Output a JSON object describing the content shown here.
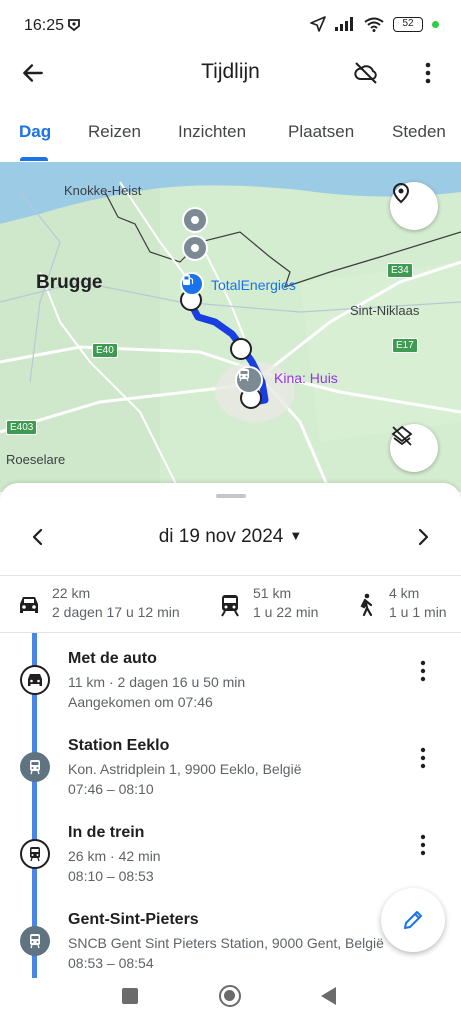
{
  "status_bar": {
    "time": "16:25",
    "battery": "52"
  },
  "app_bar": {
    "title": "Tijdlijn"
  },
  "tabs": [
    {
      "label": "Dag",
      "active": true
    },
    {
      "label": "Reizen",
      "active": false
    },
    {
      "label": "Inzichten",
      "active": false
    },
    {
      "label": "Plaatsen",
      "active": false
    },
    {
      "label": "Steden",
      "active": false
    }
  ],
  "map": {
    "cities": [
      "Knokke-Heist",
      "Brugge",
      "Sint-Niklaas",
      "Roeselare"
    ],
    "roads": [
      "E34",
      "E40",
      "E17",
      "E403"
    ],
    "pois": [
      {
        "label": "TotalEnergies",
        "color": "#1a73e8"
      },
      {
        "label": "Kina: Huis",
        "color": "#9334e6"
      }
    ]
  },
  "date_nav": {
    "date": "di 19 nov 2024"
  },
  "summary": [
    {
      "icon": "car-icon",
      "distance": "22 km",
      "duration": "2 dagen 17 u 12 min"
    },
    {
      "icon": "train-icon",
      "distance": "51 km",
      "duration": "1 u 22 min"
    },
    {
      "icon": "walk-icon",
      "distance": "4 km",
      "duration": "1 u 1 min"
    }
  ],
  "timeline": [
    {
      "type": "activity",
      "icon": "car-icon",
      "title": "Met de auto",
      "subtitle": "11 km · 2 dagen 16 u 50 min",
      "time": "Aangekomen om 07:46"
    },
    {
      "type": "place",
      "icon": "train-station-icon",
      "title": "Station Eeklo",
      "subtitle": "Kon. Astridplein 1, 9900 Eeklo, België",
      "time": "07:46 – 08:10"
    },
    {
      "type": "activity",
      "icon": "train-icon",
      "title": "In de trein",
      "subtitle": "26 km · 42 min",
      "time": "08:10 – 08:53"
    },
    {
      "type": "place",
      "icon": "train-station-icon",
      "title": "Gent-Sint-Pieters",
      "subtitle": "SNCB Gent Sint Pieters Station, 9000 Gent, België",
      "time": "08:53 – 08:54"
    }
  ],
  "colors": {
    "accent": "#1a73e8",
    "timeline": "#4a86e8",
    "route": "#1a3fe0"
  }
}
